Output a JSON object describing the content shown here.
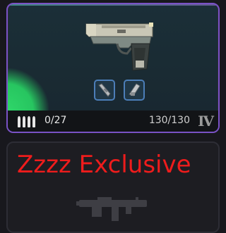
{
  "weapon_card": {
    "ammo": "0/27",
    "durability": "130/130",
    "tier": "IV",
    "rarity_color": "#2fd76a",
    "border_color": "#7a52c6",
    "icons": [
      "pistol-icon",
      "ammo-icon",
      "barrel-attachment-icon",
      "grip-attachment-icon"
    ]
  },
  "exclusive_card": {
    "label": "Zzzz Exclusive",
    "label_color": "#ee1c1c",
    "icons": [
      "rifle-icon"
    ]
  }
}
